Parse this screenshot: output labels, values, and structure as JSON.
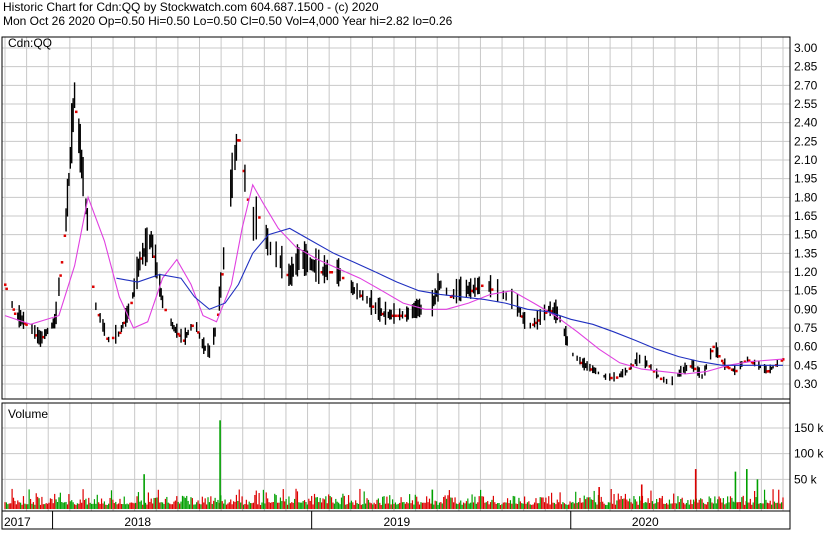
{
  "header": {
    "line1": "Historic Chart for Cdn:QQ by Stockwatch.com 604.687.1500 - (c) 2020",
    "line2": "Mon Oct 26 2020  Op=0.50  Hi=0.50  Lo=0.50  Cl=0.50  Vol=4,000  Year hi=2.82  lo=0.26"
  },
  "colors": {
    "background": "#ffffff",
    "grid": "#c8c8c8",
    "price_up_bar": "#000000",
    "price_down_tick": "#dd0000",
    "ma_short": "#e040e0",
    "ma_long": "#2030c0",
    "volume_up": "#00a000",
    "volume_down": "#dd0000"
  },
  "chart_data": [
    {
      "type": "line",
      "panel": "price",
      "title": "Cdn:QQ",
      "ylim": [
        0.2,
        3.05
      ],
      "yticks": [
        "3.00",
        "2.85",
        "2.70",
        "2.55",
        "2.40",
        "2.25",
        "2.10",
        "1.95",
        "1.80",
        "1.65",
        "1.50",
        "1.35",
        "1.20",
        "1.05",
        "0.90",
        "0.75",
        "0.60",
        "0.45",
        "0.30"
      ],
      "x_labels": [
        "2017",
        "2018",
        "2019",
        "2020"
      ],
      "x_label_dates": [
        "2017-12-01",
        "2018-05-01",
        "2019-05-01",
        "2020-04-15"
      ],
      "year_boundaries": [
        "2018-01-01",
        "2019-01-01",
        "2020-01-01"
      ],
      "x_range": [
        "2017-10-26",
        "2020-10-26"
      ],
      "grid": true,
      "series": [
        {
          "role": "price",
          "dates": [
            "2017-10-26",
            "2017-11-10",
            "2017-12-01",
            "2017-12-15",
            "2018-01-05",
            "2018-01-20",
            "2018-02-01",
            "2018-02-10",
            "2018-02-20",
            "2018-03-01",
            "2018-03-20",
            "2018-04-05",
            "2018-04-20",
            "2018-05-05",
            "2018-05-20",
            "2018-06-05",
            "2018-06-20",
            "2018-07-05",
            "2018-07-20",
            "2018-08-01",
            "2018-08-10",
            "2018-08-20",
            "2018-09-01",
            "2018-09-10",
            "2018-09-20",
            "2018-10-01",
            "2018-10-10",
            "2018-10-20",
            "2018-11-01",
            "2018-11-15",
            "2018-12-01",
            "2018-12-15",
            "2019-01-01",
            "2019-01-15",
            "2019-02-01",
            "2019-02-15",
            "2019-03-01",
            "2019-03-15",
            "2019-04-01",
            "2019-04-15",
            "2019-05-01",
            "2019-05-15",
            "2019-06-01",
            "2019-06-15",
            "2019-07-01",
            "2019-07-15",
            "2019-08-01",
            "2019-08-15",
            "2019-09-01",
            "2019-09-15",
            "2019-10-01",
            "2019-10-15",
            "2019-11-01",
            "2019-11-15",
            "2019-12-01",
            "2019-12-15",
            "2020-01-01",
            "2020-01-20",
            "2020-02-05",
            "2020-02-20",
            "2020-03-05",
            "2020-03-20",
            "2020-04-05",
            "2020-04-20",
            "2020-05-05",
            "2020-05-20",
            "2020-06-05",
            "2020-06-20",
            "2020-07-05",
            "2020-07-20",
            "2020-08-05",
            "2020-08-20",
            "2020-09-05",
            "2020-09-20",
            "2020-10-05",
            "2020-10-26"
          ],
          "values": [
            1.1,
            0.85,
            0.75,
            0.65,
            0.8,
            1.6,
            2.6,
            2.1,
            1.55,
            0.95,
            0.65,
            0.7,
            0.9,
            1.3,
            1.45,
            0.95,
            0.75,
            0.65,
            0.8,
            0.6,
            0.55,
            0.75,
            1.4,
            1.9,
            2.3,
            1.85,
            1.55,
            1.65,
            1.4,
            1.3,
            1.15,
            1.3,
            1.25,
            1.2,
            1.2,
            1.15,
            1.05,
            1.0,
            0.9,
            0.85,
            0.85,
            0.85,
            0.9,
            0.85,
            1.1,
            1.0,
            1.05,
            1.05,
            1.1,
            1.05,
            1.0,
            0.95,
            0.75,
            0.8,
            0.9,
            0.85,
            0.55,
            0.45,
            0.4,
            0.35,
            0.35,
            0.4,
            0.5,
            0.45,
            0.35,
            0.3,
            0.4,
            0.45,
            0.35,
            0.6,
            0.45,
            0.4,
            0.5,
            0.45,
            0.4,
            0.5
          ]
        },
        {
          "role": "ma_short",
          "dates": [
            "2017-10-26",
            "2017-12-01",
            "2018-01-10",
            "2018-02-01",
            "2018-02-20",
            "2018-03-15",
            "2018-04-05",
            "2018-04-25",
            "2018-05-15",
            "2018-06-05",
            "2018-06-25",
            "2018-07-15",
            "2018-08-01",
            "2018-08-20",
            "2018-09-10",
            "2018-09-25",
            "2018-10-10",
            "2018-10-25",
            "2018-11-15",
            "2018-12-10",
            "2019-01-10",
            "2019-02-10",
            "2019-03-10",
            "2019-04-10",
            "2019-05-10",
            "2019-06-10",
            "2019-07-10",
            "2019-08-10",
            "2019-09-10",
            "2019-10-10",
            "2019-11-10",
            "2019-12-10",
            "2020-01-10",
            "2020-02-10",
            "2020-03-10",
            "2020-04-10",
            "2020-05-10",
            "2020-06-10",
            "2020-07-10",
            "2020-08-10",
            "2020-09-10",
            "2020-10-26"
          ],
          "values": [
            0.85,
            0.78,
            0.85,
            1.25,
            1.8,
            1.45,
            1.0,
            0.75,
            0.8,
            1.15,
            1.3,
            1.1,
            0.85,
            0.8,
            1.1,
            1.55,
            1.9,
            1.75,
            1.55,
            1.4,
            1.3,
            1.22,
            1.15,
            1.05,
            0.95,
            0.9,
            0.9,
            0.95,
            1.02,
            1.05,
            0.95,
            0.85,
            0.72,
            0.58,
            0.47,
            0.42,
            0.4,
            0.38,
            0.4,
            0.45,
            0.48,
            0.5
          ]
        },
        {
          "role": "ma_long",
          "dates": [
            "2018-04-01",
            "2018-05-01",
            "2018-06-01",
            "2018-07-01",
            "2018-07-20",
            "2018-08-10",
            "2018-09-01",
            "2018-09-20",
            "2018-10-10",
            "2018-11-01",
            "2018-12-01",
            "2019-01-01",
            "2019-02-01",
            "2019-03-01",
            "2019-04-01",
            "2019-05-01",
            "2019-06-01",
            "2019-07-01",
            "2019-08-01",
            "2019-09-01",
            "2019-10-01",
            "2019-11-01",
            "2019-12-01",
            "2020-01-01",
            "2020-02-01",
            "2020-03-01",
            "2020-04-01",
            "2020-05-01",
            "2020-06-01",
            "2020-07-01",
            "2020-08-01",
            "2020-09-01",
            "2020-10-26"
          ],
          "values": [
            1.15,
            1.12,
            1.18,
            1.15,
            1.0,
            0.9,
            0.95,
            1.1,
            1.35,
            1.5,
            1.55,
            1.45,
            1.35,
            1.28,
            1.2,
            1.12,
            1.05,
            1.02,
            1.0,
            0.98,
            0.95,
            0.9,
            0.88,
            0.82,
            0.78,
            0.72,
            0.65,
            0.58,
            0.52,
            0.48,
            0.45,
            0.45,
            0.45
          ]
        }
      ]
    },
    {
      "type": "bar",
      "panel": "volume",
      "title": "Volume",
      "ylim": [
        0,
        190
      ],
      "yticks": [
        "150 k",
        "100 k",
        "50 k"
      ],
      "ytick_values": [
        150,
        100,
        50
      ],
      "spikes": [
        {
          "date": "2018-05-10",
          "value": 60,
          "dir": "up"
        },
        {
          "date": "2018-08-25",
          "value": 165,
          "dir": "up"
        },
        {
          "date": "2019-06-20",
          "value": 30,
          "dir": "up"
        },
        {
          "date": "2020-02-10",
          "value": 35,
          "dir": "down"
        },
        {
          "date": "2020-04-10",
          "value": 40,
          "dir": "down"
        },
        {
          "date": "2020-06-25",
          "value": 70,
          "dir": "down"
        },
        {
          "date": "2020-08-20",
          "value": 65,
          "dir": "up"
        },
        {
          "date": "2020-09-05",
          "value": 70,
          "dir": "up"
        },
        {
          "date": "2020-09-20",
          "value": 50,
          "dir": "up"
        }
      ]
    }
  ]
}
